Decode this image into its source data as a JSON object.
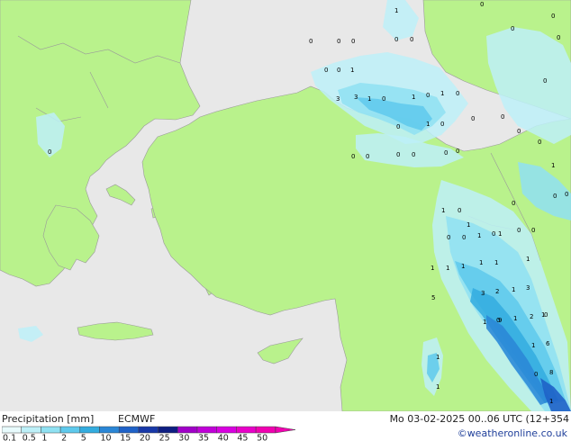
{
  "title": "Precipitation [mm]",
  "model": "ECMWF",
  "datetime": "Mo 03-02-2025 00..06 UTC (12+354",
  "credit": "©weatheronline.co.uk",
  "colors": {
    "sea": "#e8e8e8",
    "land": "#b9f28c",
    "border": "#9a9a9a"
  },
  "legend": {
    "labels": [
      "0.1",
      "0.5",
      "1",
      "2",
      "5",
      "10",
      "15",
      "20",
      "25",
      "30",
      "35",
      "40",
      "45",
      "50"
    ],
    "colors": [
      "#e8fbfd",
      "#bdf0f8",
      "#8fe1f2",
      "#5ec9ec",
      "#33acdf",
      "#2a86d6",
      "#1f62c8",
      "#1838a8",
      "#0e1e82",
      "#a000c8",
      "#c000d8",
      "#d800e0",
      "#e800c8",
      "#f000b0"
    ]
  },
  "map_values": [
    "1",
    "0",
    "0",
    "0",
    "0",
    "0",
    "0",
    "0",
    "0",
    "0",
    "0",
    "0",
    "1",
    "0",
    "3",
    "3",
    "1",
    "0",
    "1",
    "0",
    "1",
    "0",
    "0",
    "0",
    "0",
    "1",
    "0",
    "0",
    "0",
    "0",
    "0",
    "0",
    "0",
    "0",
    "1",
    "0",
    "0",
    "0",
    "0",
    "0",
    "0",
    "1",
    "0",
    "0",
    "1",
    "0",
    "1",
    "1",
    "1",
    "1",
    "1",
    "1",
    "1",
    "5",
    "3",
    "2",
    "1",
    "3",
    "1",
    "0",
    "9",
    "1",
    "2",
    "1",
    "0",
    "1",
    "6",
    "1",
    "0",
    "8",
    "1",
    "1",
    "0",
    "0",
    "1"
  ]
}
